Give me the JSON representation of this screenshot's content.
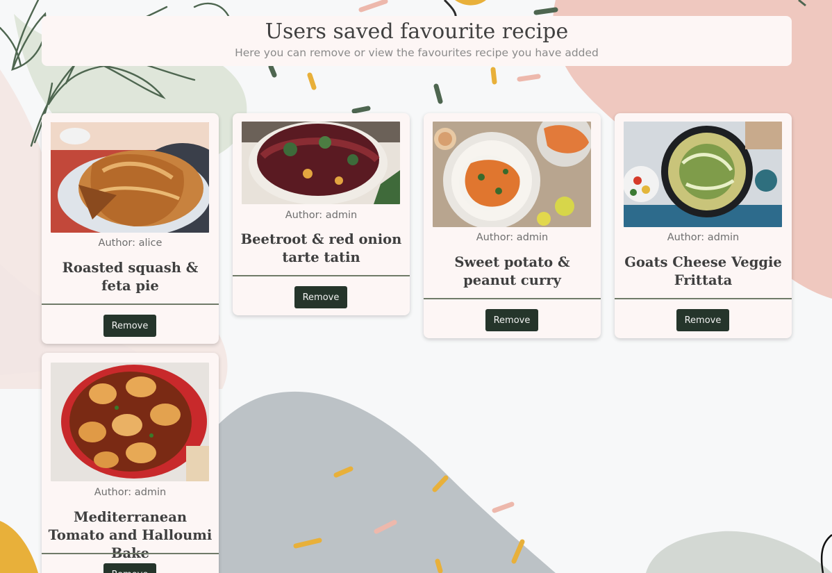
{
  "header": {
    "title": "Users saved favourite recipe",
    "subtitle": "Here you can remove or view the favourites recipe you have added"
  },
  "recipes": [
    {
      "author": "Author: alice",
      "title": "Roasted squash & feta pie",
      "remove_label": "Remove",
      "image": "squash-feta-pie-image"
    },
    {
      "author": "Author: admin",
      "title": "Beetroot & red onion tarte tatin",
      "remove_label": "Remove",
      "image": "beetroot-tarte-tatin-image"
    },
    {
      "author": "Author: admin",
      "title": "Sweet potato & peanut curry",
      "remove_label": "Remove",
      "image": "sweet-potato-curry-image"
    },
    {
      "author": "Author: admin",
      "title": "Goats Cheese Veggie Frittata",
      "remove_label": "Remove",
      "image": "goats-cheese-frittata-image"
    },
    {
      "author": "Author: admin",
      "title": "Mediterranean Tomato and Halloumi Bake",
      "remove_label": "Remove",
      "image": "tomato-halloumi-bake-image"
    }
  ],
  "colors": {
    "page_background": "#f7f8f9",
    "card_background": "#fdf6f5",
    "button_background": "#25352b",
    "divider": "#6f7a68",
    "blob_pink": "#edc8bd",
    "blob_green": "#dce5d8",
    "blob_grey": "#b9bfc3",
    "accent_yellow": "#e8b03a"
  }
}
